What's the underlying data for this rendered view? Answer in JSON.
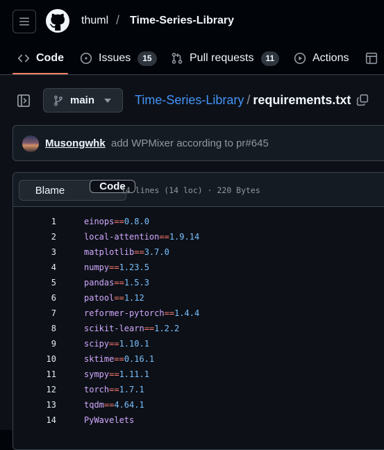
{
  "header": {
    "owner": "thuml",
    "separator": "/",
    "repo": "Time-Series-Library"
  },
  "tabs": [
    {
      "label": "Code",
      "icon": "code-icon",
      "active": true
    },
    {
      "label": "Issues",
      "icon": "issue-opened-icon",
      "count": "15"
    },
    {
      "label": "Pull requests",
      "icon": "git-pull-request-icon",
      "count": "11"
    },
    {
      "label": "Actions",
      "icon": "play-icon"
    },
    {
      "label": "",
      "icon": "table-icon"
    }
  ],
  "branch": {
    "name": "main"
  },
  "breadcrumb": {
    "repo": "Time-Series-Library",
    "separator": "/",
    "file": "requirements.txt"
  },
  "commit": {
    "author": "Musongwhk",
    "message": "add WPMixer according to pr#645"
  },
  "file": {
    "view_code": "Code",
    "view_blame": "Blame",
    "meta": "14 lines (14 loc) · 220 Bytes",
    "lines": [
      {
        "n": "1",
        "pkg": "einops",
        "op": "==",
        "ver": "0.8.0"
      },
      {
        "n": "2",
        "pkg": "local-attention",
        "op": "==",
        "ver": "1.9.14"
      },
      {
        "n": "3",
        "pkg": "matplotlib",
        "op": "==",
        "ver": "3.7.0"
      },
      {
        "n": "4",
        "pkg": "numpy",
        "op": "==",
        "ver": "1.23.5"
      },
      {
        "n": "5",
        "pkg": "pandas",
        "op": "==",
        "ver": "1.5.3"
      },
      {
        "n": "6",
        "pkg": "patool",
        "op": "==",
        "ver": "1.12"
      },
      {
        "n": "7",
        "pkg": "reformer-pytorch",
        "op": "==",
        "ver": "1.4.4"
      },
      {
        "n": "8",
        "pkg": "scikit-learn",
        "op": "==",
        "ver": "1.2.2"
      },
      {
        "n": "9",
        "pkg": "scipy",
        "op": "==",
        "ver": "1.10.1"
      },
      {
        "n": "10",
        "pkg": "sktime",
        "op": "==",
        "ver": "0.16.1"
      },
      {
        "n": "11",
        "pkg": "sympy",
        "op": "==",
        "ver": "1.11.1"
      },
      {
        "n": "12",
        "pkg": "torch",
        "op": "==",
        "ver": "1.7.1"
      },
      {
        "n": "13",
        "pkg": "tqdm",
        "op": "==",
        "ver": "4.64.1"
      },
      {
        "n": "14",
        "pkg": "PyWavelets",
        "op": "",
        "ver": ""
      }
    ]
  },
  "colors": {
    "accent_underline": "#f78166",
    "link": "#4493f8",
    "package": "#d2a8ff",
    "operator": "#ff7b72",
    "version": "#79c0ff"
  }
}
